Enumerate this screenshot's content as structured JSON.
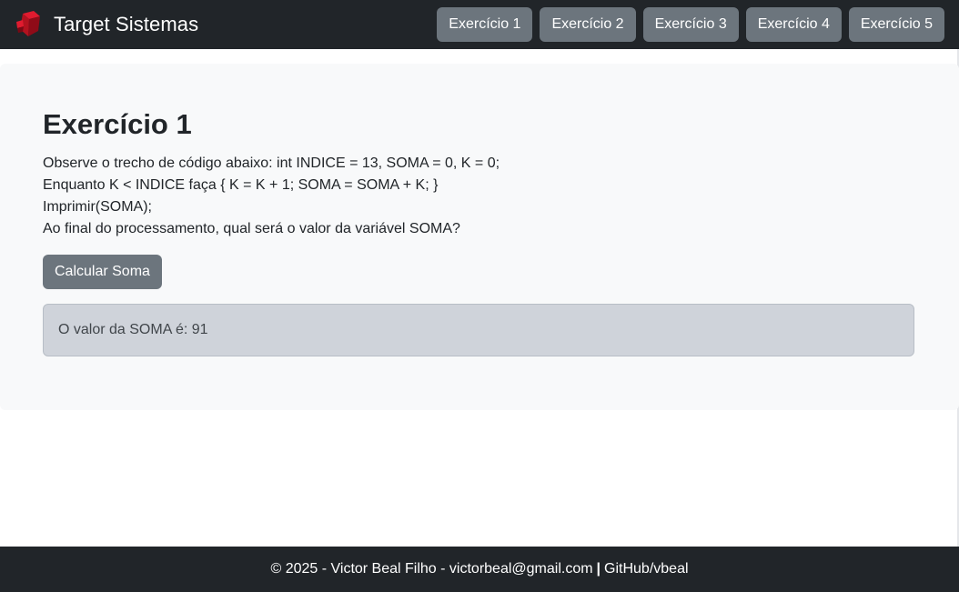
{
  "navbar": {
    "brand": "Target Sistemas",
    "logo_icon": "red-cube-logo-icon",
    "buttons": [
      "Exercício 1",
      "Exercício 2",
      "Exercício 3",
      "Exercício 4",
      "Exercício 5"
    ]
  },
  "main": {
    "title": "Exercício 1",
    "lines": [
      "Observe o trecho de código abaixo: int INDICE = 13, SOMA = 0, K = 0;",
      "Enquanto K < INDICE faça { K = K + 1; SOMA = SOMA + K; }",
      "Imprimir(SOMA);",
      "Ao final do processamento, qual será o valor da variável SOMA?"
    ],
    "button_label": "Calcular Soma",
    "result_text": "O valor da SOMA é: 91"
  },
  "footer": {
    "copyright": "© 2025 - Victor Beal Filho - victorbeal@gmail.com",
    "separator": "|",
    "github": "GitHub/vbeal"
  },
  "colors": {
    "navbar_bg": "#212529",
    "button_bg": "#6c757d",
    "panel_bg": "#f8f9fa",
    "alert_bg": "#cfd3da",
    "logo_red": "#c8102e"
  }
}
